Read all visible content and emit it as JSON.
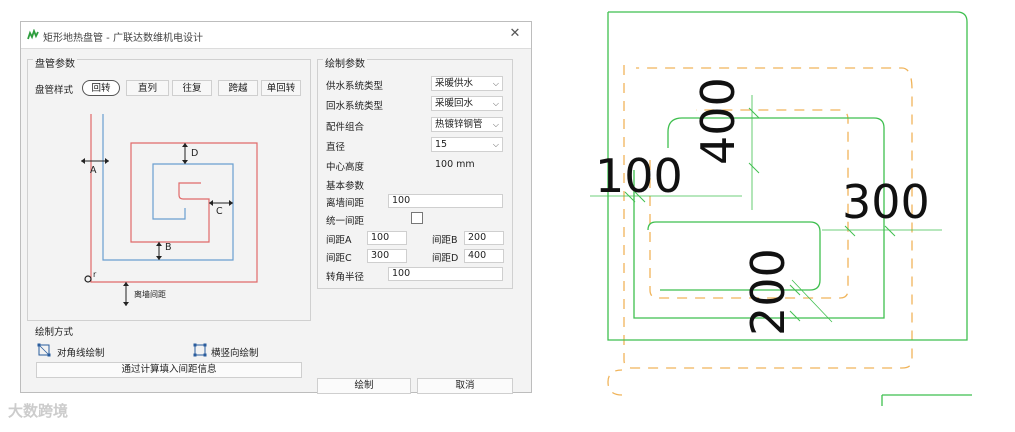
{
  "window": {
    "title": "矩形地热盘管 - 广联达数维机电设计",
    "close_glyph": "✕"
  },
  "coil_params": {
    "group_title": "盘管参数",
    "style_label": "盘管样式",
    "styles": [
      "回转",
      "直列",
      "往复",
      "跨越",
      "单回转"
    ],
    "active_style": "回转"
  },
  "diagram": {
    "label_A": "A",
    "label_B": "B",
    "label_C": "C",
    "label_D": "D",
    "label_r": "r",
    "wall_label": "离墙间距"
  },
  "draw_mode": {
    "title": "绘制方式",
    "diagonal": "对角线绘制",
    "horiz_vert": "横竖向绘制",
    "calc_button": "通过计算填入间距信息"
  },
  "draw_params": {
    "group_title": "绘制参数",
    "supply_type_label": "供水系统类型",
    "supply_type_value": "采暖供水",
    "return_type_label": "回水系统类型",
    "return_type_value": "采暖回水",
    "fitting_label": "配件组合",
    "fitting_value": "热镀锌钢管",
    "diameter_label": "直径",
    "diameter_value": "15",
    "center_height_label": "中心高度",
    "center_height_value": "100 mm",
    "basic_label": "基本参数",
    "wall_spacing_label": "离墙间距",
    "wall_spacing_value": "100",
    "uniform_label": "统一间距",
    "spacing_A_label": "间距A",
    "spacing_A_value": "100",
    "spacing_B_label": "间距B",
    "spacing_B_value": "200",
    "spacing_C_label": "间距C",
    "spacing_C_value": "300",
    "spacing_D_label": "间距D",
    "spacing_D_value": "400",
    "corner_label": "转角半径",
    "corner_value": "100"
  },
  "buttons": {
    "draw": "绘制",
    "cancel": "取消"
  },
  "watermark": "大数跨境",
  "cad_dimensions": {
    "d100": "100",
    "d400": "400",
    "d300": "300",
    "d200": "200"
  },
  "colors": {
    "supply_pipe": "#e06a6a",
    "return_pipe": "#6a9fd0",
    "cad_green": "#3fbf4f",
    "cad_orange": "#f0b45a"
  }
}
